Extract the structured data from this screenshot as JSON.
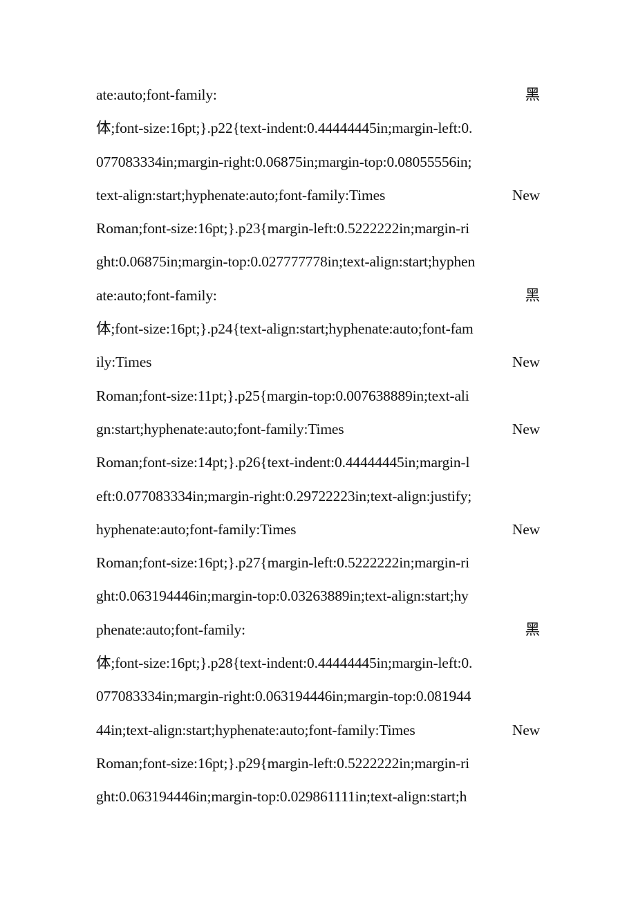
{
  "document": {
    "lines": [
      {
        "left": "ate:auto;font-family:",
        "right": "黑"
      },
      {
        "left": "体;font-size:16pt;}.p22{text-indent:0.44444445in;margin-left:0.",
        "right": ""
      },
      {
        "left": "077083334in;margin-right:0.06875in;margin-top:0.08055556in;",
        "right": ""
      },
      {
        "left": "text-align:start;hyphenate:auto;font-family:Times",
        "right": "New"
      },
      {
        "left": "Roman;font-size:16pt;}.p23{margin-left:0.5222222in;margin-ri",
        "right": ""
      },
      {
        "left": "ght:0.06875in;margin-top:0.027777778in;text-align:start;hyphen",
        "right": ""
      },
      {
        "left": "ate:auto;font-family:",
        "right": "黑"
      },
      {
        "left": "体;font-size:16pt;}.p24{text-align:start;hyphenate:auto;font-fam",
        "right": ""
      },
      {
        "left": "ily:Times",
        "right": "New"
      },
      {
        "left": "Roman;font-size:11pt;}.p25{margin-top:0.007638889in;text-ali",
        "right": ""
      },
      {
        "left": "gn:start;hyphenate:auto;font-family:Times",
        "right": "New"
      },
      {
        "left": "Roman;font-size:14pt;}.p26{text-indent:0.44444445in;margin-l",
        "right": ""
      },
      {
        "left": "eft:0.077083334in;margin-right:0.29722223in;text-align:justify;",
        "right": ""
      },
      {
        "left": "hyphenate:auto;font-family:Times",
        "right": "New"
      },
      {
        "left": "Roman;font-size:16pt;}.p27{margin-left:0.5222222in;margin-ri",
        "right": ""
      },
      {
        "left": "ght:0.063194446in;margin-top:0.03263889in;text-align:start;hy",
        "right": ""
      },
      {
        "left": "phenate:auto;font-family:",
        "right": "黑"
      },
      {
        "left": "体;font-size:16pt;}.p28{text-indent:0.44444445in;margin-left:0.",
        "right": ""
      },
      {
        "left": "077083334in;margin-right:0.063194446in;margin-top:0.081944",
        "right": ""
      },
      {
        "left": "44in;text-align:start;hyphenate:auto;font-family:Times",
        "right": "New"
      },
      {
        "left": "Roman;font-size:16pt;}.p29{margin-left:0.5222222in;margin-ri",
        "right": ""
      },
      {
        "left": "ght:0.063194446in;margin-top:0.029861111in;text-align:start;h",
        "right": ""
      }
    ]
  }
}
